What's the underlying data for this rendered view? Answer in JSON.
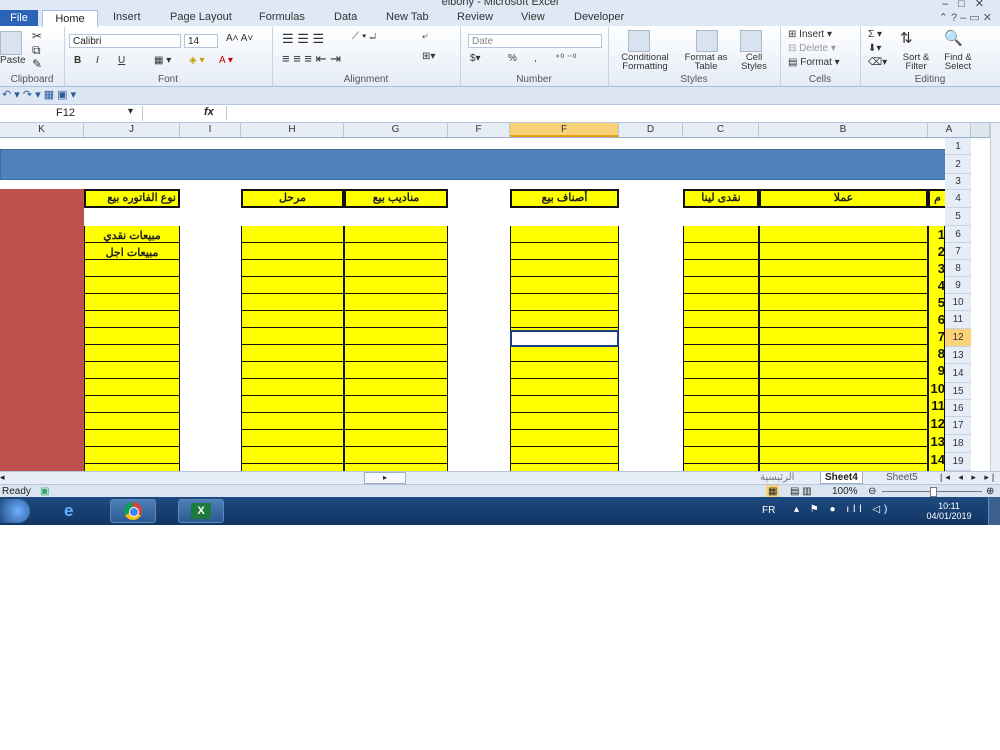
{
  "window": {
    "title": "elbony - Microsoft Excel"
  },
  "tabs": [
    "Home",
    "Insert",
    "Page Layout",
    "Formulas",
    "Data",
    "New Tab",
    "Review",
    "View",
    "Developer"
  ],
  "file_tab": "File",
  "ribbon": {
    "clipboard": {
      "label": "Clipboard",
      "paste": "Paste"
    },
    "font": {
      "label": "Font",
      "name": "Calibri",
      "size": "14",
      "bold": "B",
      "italic": "I",
      "underline": "U"
    },
    "alignment": {
      "label": "Alignment"
    },
    "number": {
      "label": "Number",
      "format": "Date",
      "percent": "%",
      "comma": ","
    },
    "styles": {
      "label": "Styles",
      "conditional": "Conditional Formatting",
      "format_table": "Format as Table",
      "cell_styles": "Cell Styles"
    },
    "cells": {
      "label": "Cells",
      "insert": "Insert",
      "delete": "Delete",
      "format": "Format"
    },
    "editing": {
      "label": "Editing",
      "sort": "Sort & Filter",
      "find": "Find & Select"
    }
  },
  "formula_bar": {
    "name_box": "F12",
    "fx": "fx",
    "value": ""
  },
  "columns": [
    "K",
    "J",
    "I",
    "H",
    "G",
    "F",
    "E",
    "D",
    "C",
    "B",
    "A"
  ],
  "rows": [
    "1",
    "2",
    "3",
    "4",
    "5",
    "6",
    "7",
    "8",
    "9",
    "10",
    "11",
    "12",
    "13",
    "14",
    "15",
    "16",
    "17",
    "18",
    "19"
  ],
  "headers": {
    "col_a": "م",
    "col_b": "عملا",
    "col_c": "نقدى لينا",
    "col_e": "أصناف بيع",
    "col_g": "مناديب بيع",
    "col_h": "مرحل",
    "col_j": "نوع الفاتوره بيع"
  },
  "invoice_types": [
    "مبيعات نقدي",
    "مبيعات اجل"
  ],
  "numbers": [
    "1",
    "2",
    "3",
    "4",
    "5",
    "6",
    "7",
    "8",
    "9",
    "10",
    "11",
    "12",
    "13",
    "14"
  ],
  "sheets": {
    "sheet4": "Sheet4",
    "sheet5": "Sheet5",
    "other": "الرئيسية"
  },
  "status": {
    "ready": "Ready",
    "zoom": "100%"
  },
  "taskbar": {
    "lang": "FR",
    "time": "10:11",
    "date": "04/01/2019"
  }
}
